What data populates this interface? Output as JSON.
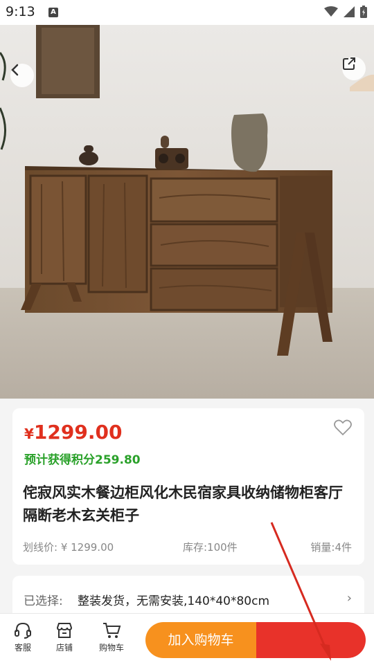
{
  "status_bar": {
    "time": "9:13",
    "notification_badge": "A"
  },
  "carousel": {
    "total_slides": 5,
    "active_slide": 1
  },
  "product": {
    "price_symbol": "¥",
    "price": "1299.00",
    "points": "预计获得积分259.80",
    "title": "侘寂风实木餐边柜风化木民宿家具收纳储物柜客厅隔断老木玄关柜子",
    "list_price": "划线价: ¥ 1299.00",
    "stock": "库存:100件",
    "sales": "销量:4件"
  },
  "selection": {
    "label": "已选择:",
    "value": "整装发货，无需安装,140*40*80cm",
    "chevron": "›"
  },
  "bottom_bar": {
    "service": "客服",
    "store": "店铺",
    "cart": "购物车",
    "add_to_cart": "加入购物车",
    "buy_now": ""
  },
  "colors": {
    "price_red": "#e0301e",
    "points_green": "#2aa12a",
    "cart_orange": "#f7911e",
    "buy_red": "#e8322a"
  }
}
